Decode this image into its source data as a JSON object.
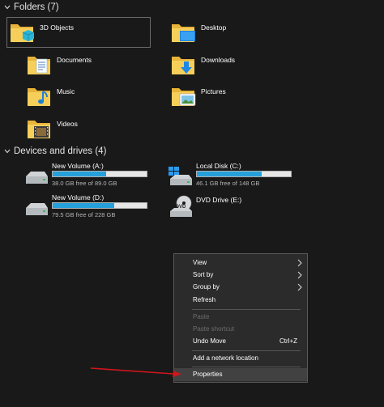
{
  "folders_header": {
    "label": "Folders (7)"
  },
  "folders": [
    {
      "label": "3D Objects",
      "icon": "3d-objects-folder-icon"
    },
    {
      "label": "Desktop",
      "icon": "desktop-folder-icon"
    },
    {
      "label": "Documents",
      "icon": "documents-folder-icon"
    },
    {
      "label": "Downloads",
      "icon": "downloads-folder-icon"
    },
    {
      "label": "Music",
      "icon": "music-folder-icon"
    },
    {
      "label": "Pictures",
      "icon": "pictures-folder-icon"
    },
    {
      "label": "Videos",
      "icon": "videos-folder-icon"
    }
  ],
  "drives_header": {
    "label": "Devices and drives (4)"
  },
  "drives": [
    {
      "name": "New Volume (A:)",
      "free": "38.0 GB free of 89.0 GB",
      "used_fraction": 0.573
    },
    {
      "name": "Local Disk (C:)",
      "free": "46.1 GB free of 148 GB",
      "used_fraction": 0.689
    },
    {
      "name": "New Volume (D:)",
      "free": "79.5 GB free of 228 GB",
      "used_fraction": 0.651
    },
    {
      "name": "DVD Drive (E:)",
      "badge": "DVD"
    }
  ],
  "context_menu": {
    "view": "View",
    "sort_by": "Sort by",
    "group_by": "Group by",
    "refresh": "Refresh",
    "paste": "Paste",
    "paste_shortcut": "Paste shortcut",
    "undo_move": "Undo Move",
    "undo_shortcut": "Ctrl+Z",
    "add_network_location": "Add a network location",
    "properties": "Properties"
  },
  "colors": {
    "background": "#191919",
    "bar_fill": "#26a0da",
    "annotation_arrow": "#d0161b"
  }
}
